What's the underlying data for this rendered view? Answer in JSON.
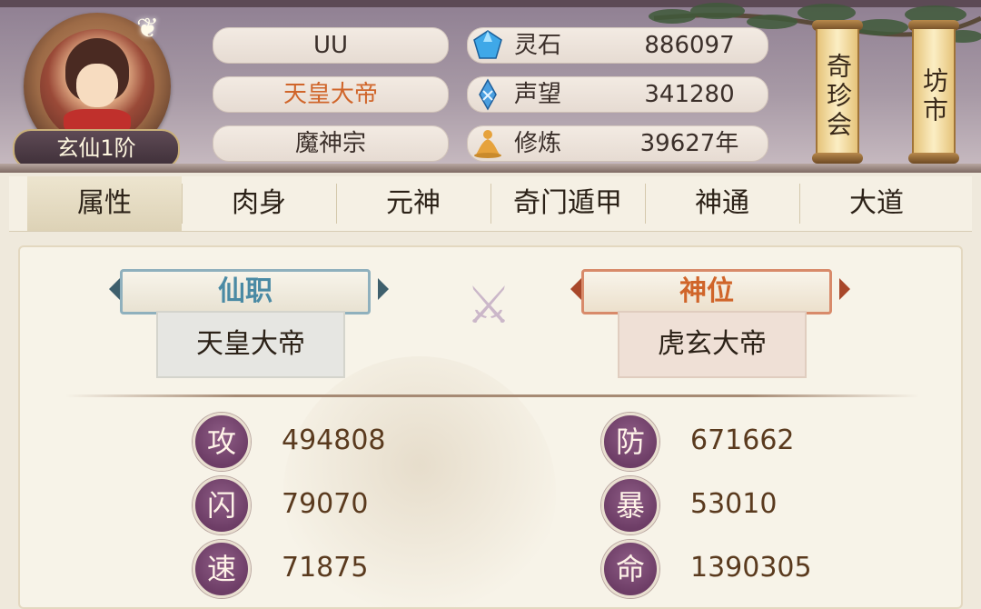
{
  "player": {
    "name": "UU",
    "title": "天皇大帝",
    "sect": "魔神宗",
    "rank": "玄仙1阶"
  },
  "resources": [
    {
      "icon": "spirit-stone-icon",
      "label": "灵石",
      "value": "886097"
    },
    {
      "icon": "prestige-icon",
      "label": "声望",
      "value": "341280"
    },
    {
      "icon": "cultivation-icon",
      "label": "修炼",
      "value": "39627年"
    }
  ],
  "buttons": {
    "treasure_hall": "奇珍会",
    "market": "坊市"
  },
  "tabs": [
    "属性",
    "肉身",
    "元神",
    "奇门遁甲",
    "神通",
    "大道"
  ],
  "active_tab": "属性",
  "positions": {
    "immortal_office": {
      "label": "仙职",
      "value": "天皇大帝"
    },
    "divine_seat": {
      "label": "神位",
      "value": "虎玄大帝"
    }
  },
  "stats": [
    {
      "label": "攻",
      "value": "494808"
    },
    {
      "label": "防",
      "value": "671662"
    },
    {
      "label": "闪",
      "value": "79070"
    },
    {
      "label": "暴",
      "value": "53010"
    },
    {
      "label": "速",
      "value": "71875"
    },
    {
      "label": "命",
      "value": "1390305"
    }
  ],
  "colors": {
    "title_orange": "#d0652a",
    "office_blue": "#4a8aa4",
    "stat_badge": "#7a4a72"
  }
}
